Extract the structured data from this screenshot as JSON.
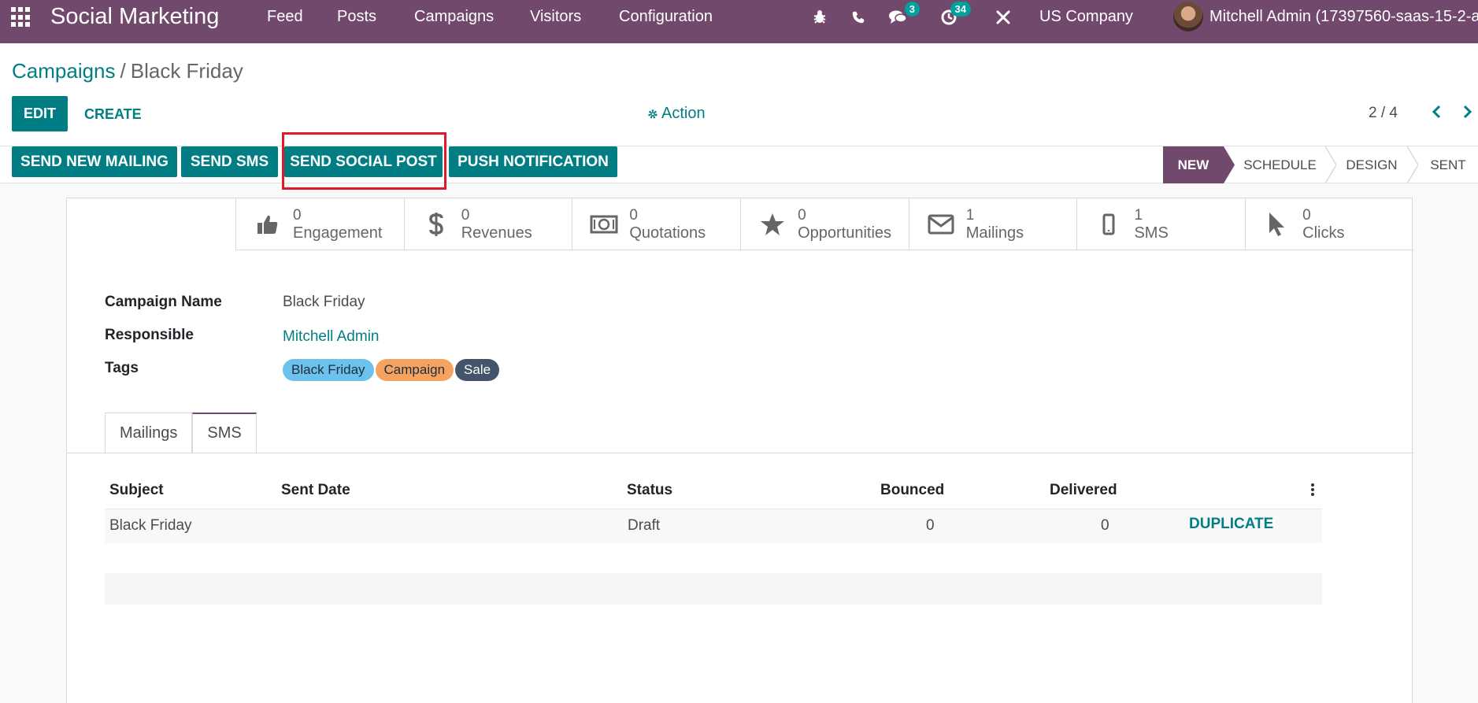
{
  "topbar": {
    "app_name": "Social Marketing",
    "menu": [
      "Feed",
      "Posts",
      "Campaigns",
      "Visitors",
      "Configuration"
    ],
    "messages_badge": "3",
    "activities_badge": "34",
    "company": "US Company",
    "user": "Mitchell Admin (17397560-saas-15-2-al"
  },
  "breadcrumb": {
    "parent": "Campaigns",
    "separator": "/",
    "current": "Black Friday"
  },
  "control": {
    "edit_label": "EDIT",
    "create_label": "CREATE",
    "action_label": "Action",
    "pager": "2 / 4"
  },
  "statusbar": {
    "buttons": [
      "SEND NEW MAILING",
      "SEND SMS",
      "SEND SOCIAL POST",
      "PUSH NOTIFICATION"
    ],
    "stages": [
      "NEW",
      "SCHEDULE",
      "DESIGN",
      "SENT"
    ],
    "active_stage": "NEW"
  },
  "smart_buttons": [
    {
      "value": "0",
      "label": "Engagement",
      "icon": "thumbs-up-icon"
    },
    {
      "value": "0",
      "label": "Revenues",
      "icon": "dollar-icon"
    },
    {
      "value": "0",
      "label": "Quotations",
      "icon": "money-icon"
    },
    {
      "value": "0",
      "label": "Opportunities",
      "icon": "star-icon"
    },
    {
      "value": "1",
      "label": "Mailings",
      "icon": "envelope-icon"
    },
    {
      "value": "1",
      "label": "SMS",
      "icon": "mobile-icon"
    },
    {
      "value": "0",
      "label": "Clicks",
      "icon": "pointer-icon"
    }
  ],
  "form": {
    "campaign_name_label": "Campaign Name",
    "campaign_name": "Black Friday",
    "responsible_label": "Responsible",
    "responsible": "Mitchell Admin",
    "tags_label": "Tags",
    "tags": [
      {
        "name": "Black Friday",
        "color": "#6cc1ed"
      },
      {
        "name": "Campaign",
        "color": "#f4a460"
      },
      {
        "name": "Sale",
        "color": "#44546a"
      }
    ]
  },
  "tabs": [
    "Mailings",
    "SMS"
  ],
  "active_tab": "SMS",
  "table": {
    "headers": [
      "Subject",
      "Sent Date",
      "Status",
      "Bounced",
      "Delivered"
    ],
    "rows": [
      {
        "subject": "Black Friday",
        "sent_date": "",
        "status": "Draft",
        "bounced": "0",
        "delivered": "0",
        "action": "DUPLICATE"
      }
    ]
  },
  "colors": {
    "brand": "#71496c",
    "accent": "#017e84",
    "highlight": "#e0182a"
  }
}
